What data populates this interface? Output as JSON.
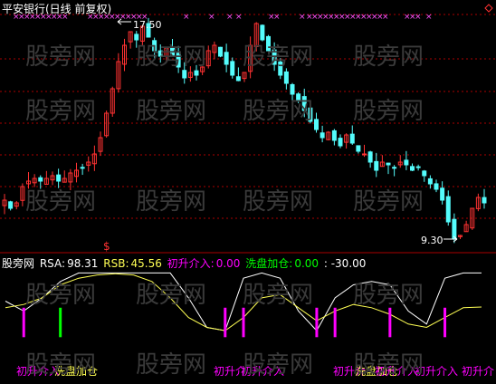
{
  "header": {
    "title": "平安银行(日线 前复权)"
  },
  "price_panel": {
    "high_label": "17.50",
    "low_label": "9.30",
    "signal_mark": "$"
  },
  "indicator_bar": {
    "name": "股旁网",
    "rsa_label": "RSA:",
    "rsa_value": "98.31",
    "rsb_label": "RSB:",
    "rsb_value": "45.56",
    "cs_label": "初升介入:",
    "cs_value": "0.00",
    "xp_label": "洗盘加仓:",
    "xp_value": "0.00",
    "extra_value": ": -30.00"
  },
  "bottom_labels": [
    "初升介入",
    "洗盘加仓",
    "初升介",
    "初升介入",
    "初升介",
    "洗盘加仓",
    "初升介入",
    "初升介入",
    "初升介"
  ],
  "watermark": "股旁网",
  "colors": {
    "background": "#000000",
    "up_candle": "#ff3232",
    "down_candle": "#54fcfc",
    "grid": "#aa0000",
    "rsa_line": "#ffffff",
    "rsb_line": "#ffff54",
    "chusheng_bar": "#ff00ff",
    "xipan_bar": "#00ff00",
    "marker": "#ff54ff"
  },
  "chart_data": [
    {
      "type": "candlestick",
      "title": "平安银行(日线 前复权)",
      "ylim": [
        9.0,
        18.0
      ],
      "annotations": [
        {
          "text": "17.50",
          "value": 17.5
        },
        {
          "text": "9.30",
          "value": 9.3
        }
      ],
      "close_path": [
        10.9,
        10.6,
        10.8,
        11.4,
        11.6,
        11.7,
        11.6,
        11.7,
        11.8,
        11.6,
        11.7,
        11.9,
        12.0,
        12.1,
        12.3,
        12.6,
        13.2,
        14.1,
        15.0,
        16.0,
        16.6,
        17.1,
        16.8,
        17.3,
        16.9,
        16.4,
        16.2,
        16.5,
        16.2,
        15.8,
        15.4,
        15.6,
        15.5,
        15.8,
        16.4,
        16.6,
        16.2,
        15.9,
        15.5,
        15.3,
        15.6,
        16.6,
        17.4,
        16.8,
        16.4,
        15.9,
        15.5,
        15.2,
        14.8,
        14.6,
        14.2,
        13.8,
        13.5,
        13.2,
        13.4,
        13.1,
        12.9,
        13.3,
        13.0,
        12.7,
        12.6,
        12.3,
        12.0,
        12.3,
        12.2,
        12.1,
        12.3,
        12.2,
        12.0,
        12.1,
        11.8,
        11.5,
        11.3,
        10.9,
        10.1,
        9.5,
        9.6,
        10.0,
        10.6,
        11.0,
        10.8
      ]
    },
    {
      "type": "line",
      "title": "",
      "ylim": [
        -30,
        100
      ],
      "series": [
        {
          "name": "RSA",
          "values": [
            55,
            40,
            60,
            85,
            98,
            98,
            98,
            98,
            98,
            98,
            60,
            15,
            10,
            90,
            98,
            90,
            40,
            10,
            60,
            80,
            85,
            80,
            40,
            20,
            90,
            98,
            98
          ]
        },
        {
          "name": "RSB",
          "values": [
            45,
            50,
            60,
            80,
            90,
            95,
            97,
            95,
            85,
            60,
            30,
            15,
            10,
            30,
            60,
            65,
            45,
            25,
            40,
            50,
            45,
            35,
            20,
            15,
            30,
            45,
            46
          ]
        },
        {
          "name": "初升介入",
          "values": [
            0,
            100,
            0,
            0,
            0,
            0,
            0,
            0,
            0,
            0,
            0,
            0,
            100,
            100,
            0,
            0,
            0,
            100,
            100,
            0,
            0,
            100,
            0,
            0,
            100,
            0,
            0
          ]
        },
        {
          "name": "洗盘加仓",
          "values": [
            0,
            0,
            0,
            100,
            0,
            0,
            0,
            0,
            0,
            0,
            0,
            0,
            0,
            0,
            0,
            0,
            0,
            0,
            0,
            0,
            0,
            0,
            0,
            0,
            0,
            0,
            0
          ]
        }
      ]
    }
  ]
}
